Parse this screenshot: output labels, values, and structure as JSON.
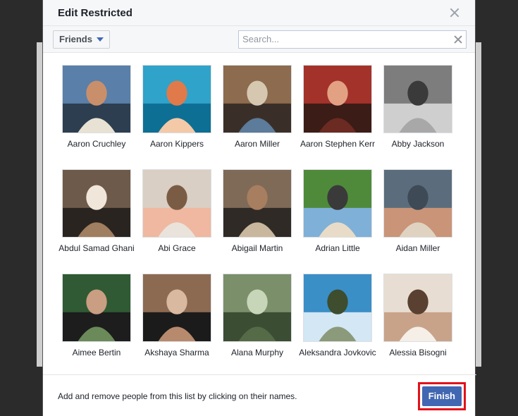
{
  "dialog": {
    "title": "Edit Restricted"
  },
  "toolbar": {
    "filter_label": "Friends",
    "search_placeholder": "Search..."
  },
  "people": [
    {
      "name": "Aaron Cruchley"
    },
    {
      "name": "Aaron Kippers"
    },
    {
      "name": "Aaron Miller"
    },
    {
      "name": "Aaron Stephen Kerr"
    },
    {
      "name": "Abby Jackson"
    },
    {
      "name": "Abdul Samad Ghani"
    },
    {
      "name": "Abi Grace"
    },
    {
      "name": "Abigail Martin"
    },
    {
      "name": "Adrian Little"
    },
    {
      "name": "Aidan Miller"
    },
    {
      "name": "Aimee Bertin"
    },
    {
      "name": "Akshaya Sharma"
    },
    {
      "name": "Alana Murphy"
    },
    {
      "name": "Aleksandra Jovkovic"
    },
    {
      "name": "Alessia Bisogni"
    }
  ],
  "footer": {
    "instructions": "Add and remove people from this list by clicking on their names.",
    "finish_label": "Finish"
  },
  "colors": {
    "primary_button": "#4267b2",
    "highlight": "#e3111b"
  }
}
